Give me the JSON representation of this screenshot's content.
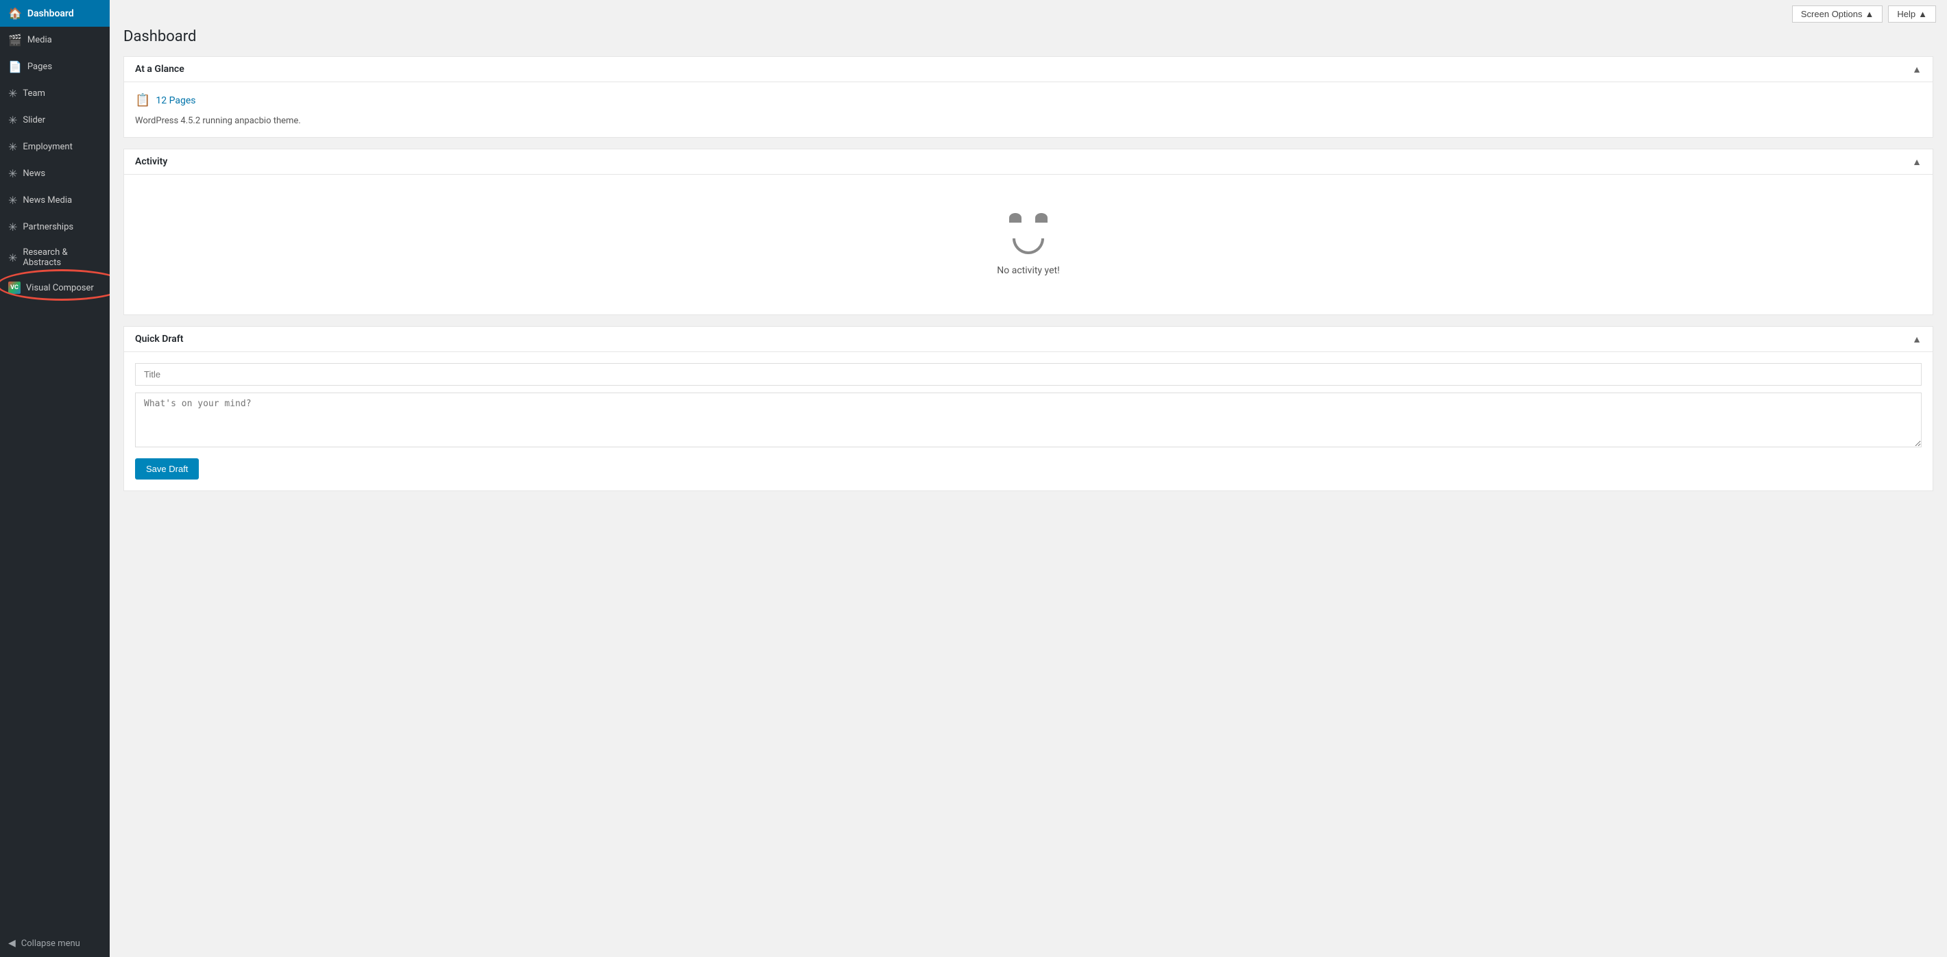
{
  "sidebar": {
    "dashboard_label": "Dashboard",
    "items": [
      {
        "id": "media",
        "label": "Media",
        "icon": "🎬"
      },
      {
        "id": "pages",
        "label": "Pages",
        "icon": "📄"
      },
      {
        "id": "team",
        "label": "Team",
        "icon": "✳"
      },
      {
        "id": "slider",
        "label": "Slider",
        "icon": "✳"
      },
      {
        "id": "employment",
        "label": "Employment",
        "icon": "✳"
      },
      {
        "id": "news",
        "label": "News",
        "icon": "✳"
      },
      {
        "id": "news-media",
        "label": "News Media",
        "icon": "✳"
      },
      {
        "id": "partnerships",
        "label": "Partnerships",
        "icon": "✳"
      },
      {
        "id": "research-abstracts",
        "label": "Research & Abstracts",
        "icon": "✳"
      }
    ],
    "visual_composer_label": "Visual Composer",
    "collapse_label": "Collapse menu"
  },
  "topbar": {
    "screen_options_label": "Screen Options",
    "help_label": "Help"
  },
  "page": {
    "title": "Dashboard"
  },
  "at_a_glance": {
    "panel_title": "At a Glance",
    "pages_count": "12 Pages",
    "wp_info": "WordPress 4.5.2 running anpacbio theme."
  },
  "activity": {
    "panel_title": "Activity",
    "empty_text": "No activity yet!"
  },
  "quick_draft": {
    "panel_title": "Quick Draft",
    "title_placeholder": "Title",
    "content_placeholder": "What's on your mind?",
    "save_button_label": "Save Draft"
  }
}
